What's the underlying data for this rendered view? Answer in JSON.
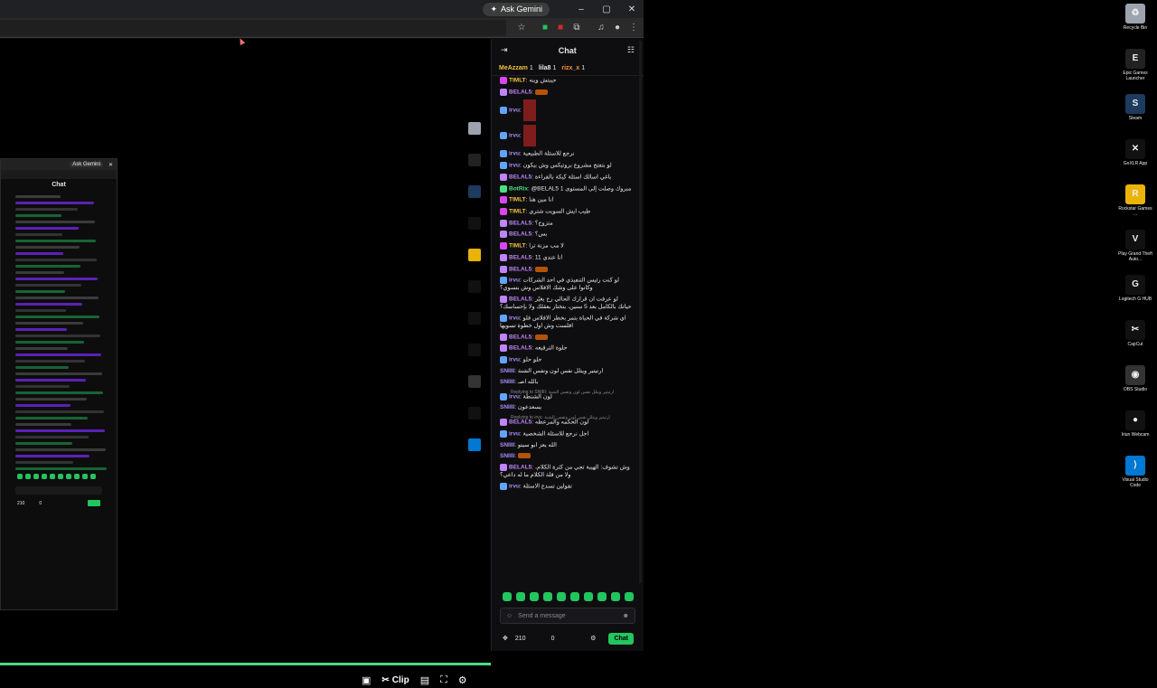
{
  "browser": {
    "ask_gemini": "Ask Gemini",
    "window_controls": [
      "–",
      "▢",
      "✕"
    ]
  },
  "stream": {
    "controls": {
      "clip_label": "Clip"
    },
    "mini_window": {
      "ask_gemini": "Ask Gemini",
      "chat_title": "Chat",
      "footer_count": "210",
      "footer_zero": "0"
    }
  },
  "chat": {
    "title": "Chat",
    "gifters": [
      {
        "name": "MeAzzam",
        "count": "1"
      },
      {
        "name": "lila8",
        "count": "1"
      },
      {
        "name": "rizx_x",
        "count": "1"
      }
    ],
    "messages": [
      {
        "badge": "b-sub",
        "user": "TIMLT",
        "text": "حيبتش وينه",
        "color": "#f0c040"
      },
      {
        "badge": "b-vip",
        "user": "BELAL5",
        "text": "",
        "emote": true,
        "color": "#c084fc"
      },
      {
        "badge": "b-blue",
        "user": "irvu",
        "text": "",
        "img": true,
        "color": "#a78bfa"
      },
      {
        "badge": "b-blue",
        "user": "irvu",
        "text": "",
        "img": true,
        "color": "#a78bfa"
      },
      {
        "badge": "b-blue",
        "user": "irvu",
        "text": "نرجع للاسئلة الطبيعية",
        "color": "#a78bfa"
      },
      {
        "badge": "b-blue",
        "user": "irvu",
        "text": "لو بتفتح مشروع بروتيكس وش بيكون",
        "color": "#a78bfa"
      },
      {
        "badge": "b-vip",
        "user": "BELAL5",
        "text": "باغي اسالك اسئلة كيكة بالقراءة",
        "color": "#c084fc"
      },
      {
        "badge": "b-mod",
        "user": "BotRix",
        "text": "@BELAL5 مبروك وصلت إلى المستوى 1",
        "color": "#4ade80"
      },
      {
        "badge": "b-sub",
        "user": "TIMLT",
        "text": "انا مين هنا",
        "color": "#f0c040"
      },
      {
        "badge": "b-sub",
        "user": "TIMLT",
        "text": "طيب ايش السويت شتري",
        "color": "#f0c040"
      },
      {
        "badge": "b-vip",
        "user": "BELAL5",
        "text": "متزوج؟",
        "color": "#c084fc"
      },
      {
        "badge": "b-vip",
        "user": "BELAL5",
        "text": "بس؟",
        "color": "#c084fc"
      },
      {
        "badge": "b-sub",
        "user": "TIMLT",
        "text": "لا مب مزنة ترا",
        "color": "#f0c040"
      },
      {
        "badge": "b-vip",
        "user": "BELAL5",
        "text": "انا عندي 11",
        "color": "#c084fc"
      },
      {
        "badge": "b-vip",
        "user": "BELAL5",
        "text": "",
        "emote": true,
        "color": "#c084fc"
      },
      {
        "badge": "b-blue",
        "user": "irvu",
        "text": "لو كنت رئيس التنفيذي في احد الشركات وكانوا على وشك الافلاس وش بتسوي؟",
        "color": "#a78bfa"
      },
      {
        "badge": "b-vip",
        "user": "BELAL5",
        "text": "لو عرفت ان قرارك الحالي رح يغيّر حياتك بالكامل بعد 5 سنين، بتختار بعقلك ولا بإحساسك؟",
        "color": "#c084fc"
      },
      {
        "badge": "b-blue",
        "user": "irvu",
        "text": "اي شركة في الحياة بتمر بخطر الافلاس فلو افلست وش اول خطوة تسويها",
        "color": "#a78bfa"
      },
      {
        "badge": "b-vip",
        "user": "BELAL5",
        "text": "",
        "emote": true,
        "color": "#c084fc"
      },
      {
        "badge": "b-vip",
        "user": "BELAL5",
        "text": "حلوة الترقيعه",
        "color": "#c084fc"
      },
      {
        "badge": "b-blue",
        "user": "irvu",
        "text": "حلو حلو",
        "color": "#a78bfa"
      },
      {
        "badge": "",
        "user": "SNIIII",
        "text": "ارتيتير ويتلل نفس لون وتفس الشنة",
        "color": "#a78bfa"
      },
      {
        "badge": "",
        "user": "SNIIII",
        "text": "بالله اصـ",
        "color": "#a78bfa"
      },
      {
        "reply": "Replying to SNIIII: ارتيتير ويتلل نفس لون وتفس الشنة"
      },
      {
        "badge": "b-blue",
        "user": "irvu",
        "text": "لون الشنطة",
        "color": "#a78bfa"
      },
      {
        "badge": "",
        "user": "SNIIII",
        "text": "يسعدعون",
        "color": "#a78bfa"
      },
      {
        "reply": "Replying to irvu: ارتيتير ويتلل نفس لون وتفس الشنة"
      },
      {
        "badge": "b-vip",
        "user": "BELAL5",
        "text": "لون الحكمه والمرعظه",
        "color": "#c084fc"
      },
      {
        "badge": "b-blue",
        "user": "irvu",
        "text": "اجل نرجع للاسئلة الشخصية",
        "color": "#a78bfa"
      },
      {
        "badge": "",
        "user": "SNIIII",
        "text": "الله يعز ابو سيتو",
        "color": "#a78bfa"
      },
      {
        "badge": "",
        "user": "SNIIII",
        "text": "",
        "emote": true,
        "color": "#a78bfa"
      },
      {
        "badge": "b-vip",
        "user": "BELAL5",
        "text": "وش تشوف: الهيبة تجي من كثرة الكلام، ولا من قلة الكلام ما له داعي؟",
        "color": "#c084fc"
      },
      {
        "badge": "b-blue",
        "user": "irvu",
        "text": "تقولين تسدع الاسئلة",
        "color": "#a78bfa"
      }
    ],
    "input_placeholder": "Send a message",
    "footer": {
      "count": "210",
      "zero": "0",
      "send_label": "Chat"
    }
  },
  "desktop": {
    "icons": [
      {
        "label": "Recycle Bin",
        "icon": "recycle-bin-icon",
        "color": "#9ca3af",
        "glyph": "♻"
      },
      {
        "label": "Epic Games Launcher",
        "icon": "epic-games-icon",
        "color": "#222",
        "glyph": "E"
      },
      {
        "label": "Steam",
        "icon": "steam-icon",
        "color": "#1e3a5f",
        "glyph": "S"
      },
      {
        "label": "GoXLR App",
        "icon": "goxlr-icon",
        "color": "#111",
        "glyph": "✕"
      },
      {
        "label": "Rockstar Games ...",
        "icon": "rockstar-icon",
        "color": "#eab308",
        "glyph": "R"
      },
      {
        "label": "Play Grand Theft Auto...",
        "icon": "gta-icon",
        "color": "#111",
        "glyph": "V"
      },
      {
        "label": "Logitech G HUB",
        "icon": "logitech-icon",
        "color": "#111",
        "glyph": "G"
      },
      {
        "label": "CapCut",
        "icon": "capcut-icon",
        "color": "#111",
        "glyph": "✂"
      },
      {
        "label": "OBS Studio",
        "icon": "obs-icon",
        "color": "#333",
        "glyph": "◉"
      },
      {
        "label": "Iriun Webcam",
        "icon": "iriun-icon",
        "color": "#111",
        "glyph": "●"
      },
      {
        "label": "Visual Studio Code",
        "icon": "vscode-icon",
        "color": "#0078d4",
        "glyph": "⟩"
      }
    ]
  }
}
